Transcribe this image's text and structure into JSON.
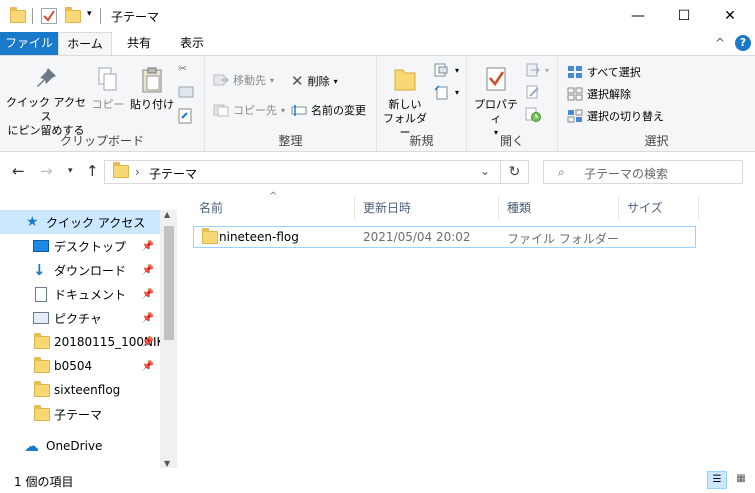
{
  "window": {
    "title": "子テーマ",
    "minimize_glyph": "—",
    "maximize_glyph": "☐",
    "close_glyph": "✕"
  },
  "tabs": {
    "file": "ファイル",
    "home": "ホーム",
    "share": "共有",
    "view": "表示",
    "collapse_glyph": "^",
    "help_glyph": "?"
  },
  "ribbon": {
    "clipboard": {
      "label": "クリップボード",
      "pin_quick_line1": "クイック アクセス",
      "pin_quick_line2": "にピン留めする",
      "copy": "コピー",
      "paste": "貼り付け"
    },
    "organize": {
      "label": "整理",
      "move_to": "移動先",
      "copy_to": "コピー先",
      "delete": "削除",
      "rename": "名前の変更"
    },
    "new": {
      "label": "新規",
      "new_folder_line1": "新しい",
      "new_folder_line2": "フォルダー"
    },
    "open": {
      "label": "開く",
      "properties": "プロパティ"
    },
    "select": {
      "label": "選択",
      "select_all": "すべて選択",
      "select_none": "選択解除",
      "invert": "選択の切り替え"
    }
  },
  "address": {
    "path": "子テーマ",
    "search_placeholder": "子テーマの検索"
  },
  "nav": {
    "items": [
      {
        "label": "クイック アクセス"
      },
      {
        "label": "デスクトップ"
      },
      {
        "label": "ダウンロード"
      },
      {
        "label": "ドキュメント"
      },
      {
        "label": "ピクチャ"
      },
      {
        "label": "20180115_100NIK"
      },
      {
        "label": "b0504"
      },
      {
        "label": "sixteenflog"
      },
      {
        "label": "子テーマ"
      },
      {
        "label": "OneDrive"
      }
    ]
  },
  "columns": {
    "name": "名前",
    "modified": "更新日時",
    "type": "種類",
    "size": "サイズ"
  },
  "files": [
    {
      "name": "nineteen-flog",
      "modified": "2021/05/04 20:02",
      "type": "ファイル フォルダー",
      "size": ""
    }
  ],
  "status": {
    "count": "1 個の項目"
  },
  "colors": {
    "accent": "#1979ca",
    "selection": "#cce8ff",
    "folder": "#f8d775"
  }
}
